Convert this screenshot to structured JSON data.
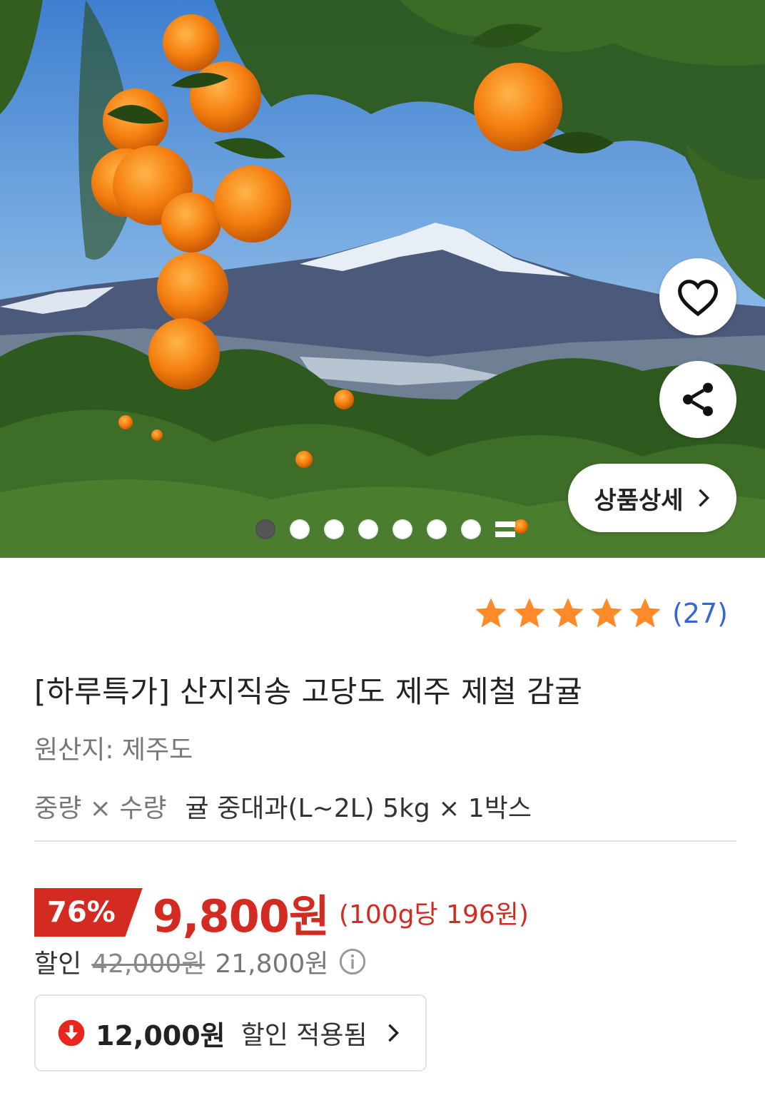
{
  "hero": {
    "detail_button_label": "상품상세",
    "slide_count": 7,
    "active_slide": 1
  },
  "rating": {
    "stars": 5,
    "review_count": "(27)",
    "star_color": "#ff8a2a"
  },
  "product": {
    "title": "[하루특가] 산지직송 고당도 제주 제철 감귤",
    "origin": "원산지: 제주도",
    "spec_label": "중량 × 수량",
    "spec_value": "귤 중대과(L~2L) 5kg × 1박스"
  },
  "pricing": {
    "discount_rate": "76%",
    "price": "9,800원",
    "unit_price": "(100g당 196원)",
    "discount_label": "할인",
    "original_price": "42,000원",
    "sale_price": "21,800원",
    "accent_color": "#d32a22"
  },
  "coupon": {
    "amount": "12,000원",
    "text": "할인 적용됨"
  },
  "icons": [
    "heart-icon",
    "share-icon",
    "chevron-right-icon",
    "star-icon",
    "info-icon",
    "arrow-down-circle-icon"
  ]
}
